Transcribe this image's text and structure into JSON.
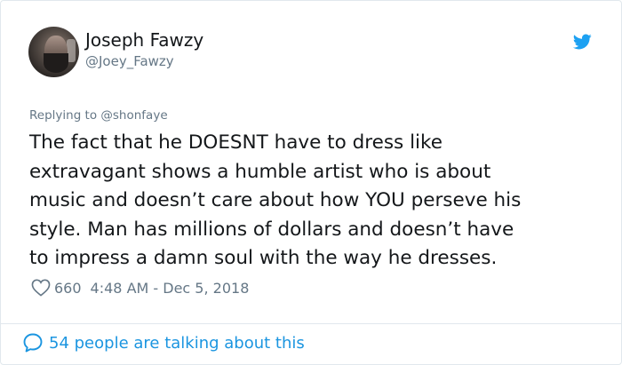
{
  "tweet": {
    "author": {
      "display_name": "Joseph Fawzy",
      "handle": "@Joey_Fawzy"
    },
    "replying_to": "Replying to @shonfaye",
    "text_lines": [
      "The fact that he DOESNT have to dress like",
      "extravagant shows a humble artist who is about",
      "music and doesn’t care about how YOU perseve his",
      "style. Man has millions of dollars and doesn’t have",
      "to impress a damn soul with the way he dresses."
    ],
    "likes": "660",
    "timestamp": "4:48 AM - Dec 5, 2018",
    "conversation_link": "54 people are talking about this",
    "icons": {
      "brand": "twitter-bird-icon",
      "like": "heart-icon",
      "conversation": "speech-bubble-icon"
    },
    "colors": {
      "brand_blue": "#1da1f2",
      "link_blue": "#1b95e0",
      "secondary_text": "#657786",
      "primary_text": "#14171a",
      "border": "#e1e8ed"
    }
  }
}
